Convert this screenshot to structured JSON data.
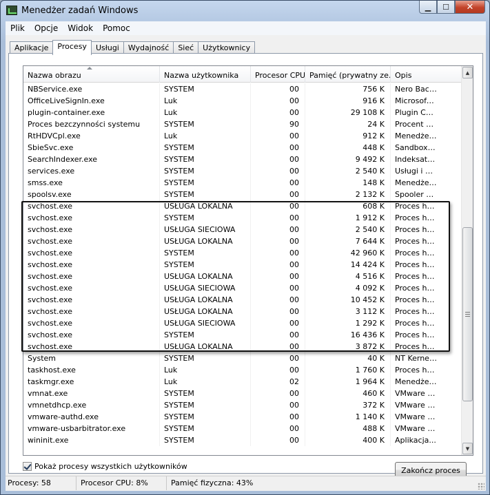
{
  "window": {
    "title": "Menedżer zadań Windows"
  },
  "caption": {
    "minimize": "▁",
    "maximize": "☐",
    "close": "✕"
  },
  "menu": [
    "Plik",
    "Opcje",
    "Widok",
    "Pomoc"
  ],
  "tabs": [
    {
      "label": "Aplikacje",
      "active": false
    },
    {
      "label": "Procesy",
      "active": true
    },
    {
      "label": "Usługi",
      "active": false
    },
    {
      "label": "Wydajność",
      "active": false
    },
    {
      "label": "Sieć",
      "active": false
    },
    {
      "label": "Użytkownicy",
      "active": false
    }
  ],
  "table": {
    "columns": [
      "Nazwa obrazu",
      "Nazwa użytkownika",
      "Procesor CPU",
      "Pamięć (prywatny ze...",
      "Opis"
    ],
    "rows": [
      [
        "NBService.exe",
        "SYSTEM",
        "00",
        "756 K",
        "Nero Back..."
      ],
      [
        "OfficeLiveSignIn.exe",
        "Luk",
        "00",
        "916 K",
        "Microsoft ..."
      ],
      [
        "plugin-container.exe",
        "Luk",
        "00",
        "29 108 K",
        "Plugin Co..."
      ],
      [
        "Proces bezczynności systemu",
        "SYSTEM",
        "90",
        "24 K",
        "Procent c..."
      ],
      [
        "RtHDVCpl.exe",
        "Luk",
        "00",
        "912 K",
        "Menedżer..."
      ],
      [
        "SbieSvc.exe",
        "SYSTEM",
        "00",
        "448 K",
        "Sandboxi..."
      ],
      [
        "SearchIndexer.exe",
        "SYSTEM",
        "00",
        "9 492 K",
        "Indeksato..."
      ],
      [
        "services.exe",
        "SYSTEM",
        "00",
        "2 540 K",
        "Usługi i a..."
      ],
      [
        "smss.exe",
        "SYSTEM",
        "00",
        "148 K",
        "Menedżer..."
      ],
      [
        "spoolsv.exe",
        "SYSTEM",
        "00",
        "2 132 K",
        "Spooler S..."
      ],
      [
        "svchost.exe",
        "USŁUGA LOKALNA",
        "00",
        "608 K",
        "Proces ho..."
      ],
      [
        "svchost.exe",
        "SYSTEM",
        "00",
        "1 912 K",
        "Proces ho..."
      ],
      [
        "svchost.exe",
        "USŁUGA SIECIOWA",
        "00",
        "2 540 K",
        "Proces ho..."
      ],
      [
        "svchost.exe",
        "USŁUGA LOKALNA",
        "00",
        "7 644 K",
        "Proces ho..."
      ],
      [
        "svchost.exe",
        "SYSTEM",
        "00",
        "42 960 K",
        "Proces ho..."
      ],
      [
        "svchost.exe",
        "SYSTEM",
        "00",
        "14 424 K",
        "Proces ho..."
      ],
      [
        "svchost.exe",
        "USŁUGA LOKALNA",
        "00",
        "4 516 K",
        "Proces ho..."
      ],
      [
        "svchost.exe",
        "USŁUGA SIECIOWA",
        "00",
        "4 092 K",
        "Proces ho..."
      ],
      [
        "svchost.exe",
        "USŁUGA LOKALNA",
        "00",
        "10 452 K",
        "Proces ho..."
      ],
      [
        "svchost.exe",
        "USŁUGA LOKALNA",
        "00",
        "3 112 K",
        "Proces ho..."
      ],
      [
        "svchost.exe",
        "USŁUGA SIECIOWA",
        "00",
        "1 292 K",
        "Proces ho..."
      ],
      [
        "svchost.exe",
        "SYSTEM",
        "00",
        "16 436 K",
        "Proces ho..."
      ],
      [
        "svchost.exe",
        "USŁUGA LOKALNA",
        "00",
        "3 872 K",
        "Proces ho..."
      ],
      [
        "System",
        "SYSTEM",
        "00",
        "40 K",
        "NT Kernel..."
      ],
      [
        "taskhost.exe",
        "Luk",
        "00",
        "1 760 K",
        "Proces ho..."
      ],
      [
        "taskmgr.exe",
        "Luk",
        "02",
        "1 964 K",
        "Menedżer..."
      ],
      [
        "vmnat.exe",
        "SYSTEM",
        "00",
        "460 K",
        "VMware N..."
      ],
      [
        "vmnetdhcp.exe",
        "SYSTEM",
        "00",
        "372 K",
        "VMware V..."
      ],
      [
        "vmware-authd.exe",
        "SYSTEM",
        "00",
        "1 140 K",
        "VMware A..."
      ],
      [
        "vmware-usbarbitrator.exe",
        "SYSTEM",
        "00",
        "488 K",
        "VMware U..."
      ],
      [
        "wininit.exe",
        "SYSTEM",
        "00",
        "400 K",
        "Aplikacja..."
      ]
    ]
  },
  "show_all_users": {
    "label": "Pokaż procesy wszystkich użytkowników",
    "checked": true
  },
  "end_process_button": "Zakończ proces",
  "status": {
    "processes": "Procesy: 58",
    "cpu": "Procesor CPU: 8%",
    "memory": "Pamięć fizyczna: 43%"
  }
}
